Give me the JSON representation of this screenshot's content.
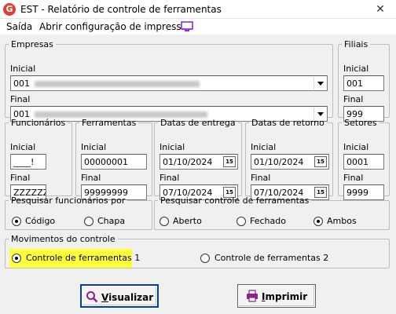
{
  "window": {
    "title": "EST - Relatório de controle de ferramentas",
    "close_label": "✕",
    "icon_letter": "G"
  },
  "menu": {
    "exit_label": "Saída",
    "print_config_label": "Abrir configuração de impressão"
  },
  "empresas": {
    "legend": "Empresas",
    "initial_label": "Inicial",
    "initial_value": "001",
    "final_label": "Final",
    "final_value": "001"
  },
  "filiais": {
    "legend": "Filiais",
    "initial_label": "Inicial",
    "initial_value": "001",
    "final_label": "Final",
    "final_value": "999"
  },
  "funcionarios": {
    "legend": "Funcionários",
    "initial_label": "Inicial",
    "initial_value": "____!",
    "final_label": "Final",
    "final_value": "ZZZZZZ"
  },
  "ferramentas": {
    "legend": "Ferramentas",
    "initial_label": "Inicial",
    "initial_value": "00000001",
    "final_label": "Final",
    "final_value": "99999999"
  },
  "datas_entrega": {
    "legend": "Datas de entrega",
    "initial_label": "Inicial",
    "initial_value": "01/10/2024",
    "final_label": "Final",
    "final_value": "07/10/2024"
  },
  "datas_retorno": {
    "legend": "Datas de retorno",
    "initial_label": "Inicial",
    "initial_value": "01/10/2024",
    "final_label": "Final",
    "final_value": "07/10/2024"
  },
  "setores": {
    "legend": "Setores",
    "initial_label": "Inicial",
    "initial_value": "0001",
    "final_label": "Final",
    "final_value": "9999"
  },
  "calendar_glyph": "15",
  "pesquisar_funcionarios": {
    "legend": "Pesquisar funcionários por",
    "options": [
      "Código",
      "Chapa"
    ],
    "selected": "Código"
  },
  "pesquisar_controle": {
    "legend": "Pesquisar controle de ferramentas",
    "options": [
      "Aberto",
      "Fechado",
      "Ambos"
    ],
    "selected": "Ambos"
  },
  "movimentos": {
    "legend": "Movimentos do controle",
    "options": [
      "Controle de ferramentas 1",
      "Controle de ferramentas 2"
    ],
    "selected": "Controle de ferramentas 1",
    "highlight_color": "#ffff3a"
  },
  "buttons": {
    "visualizar_hotkey": "V",
    "visualizar_rest": "isualizar",
    "imprimir_hotkey": "I",
    "imprimir_rest": "mprimir"
  },
  "colors": {
    "accent": "#0b3d91",
    "title_icon": "#d9442f",
    "monitor_icon": "#8a2be2",
    "printer_icon": "#8e1f8e"
  }
}
